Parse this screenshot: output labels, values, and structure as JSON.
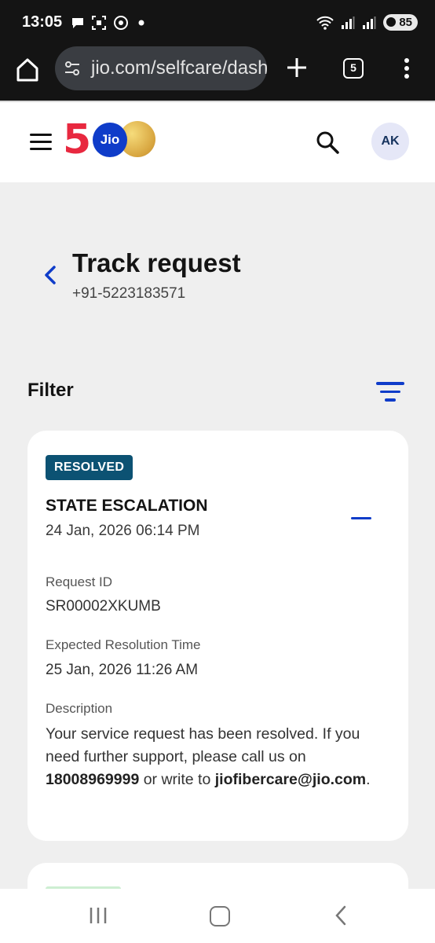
{
  "status_bar": {
    "time": "13:05",
    "battery": "85",
    "icons": [
      "chat-icon",
      "screenshot-icon",
      "whatsapp-icon",
      "dot-icon",
      "wifi-icon",
      "signal-icon",
      "signal-icon",
      "battery-icon"
    ]
  },
  "browser": {
    "url": "jio.com/selfcare/dashboard",
    "tab_count": "5",
    "icons": [
      "home-icon",
      "tune-icon",
      "plus-icon",
      "tabs-icon",
      "more-vert-icon"
    ]
  },
  "header": {
    "logo_number": "5",
    "logo_brand": "Jio",
    "avatar_initials": "AK",
    "icons": [
      "hamburger-icon",
      "search-icon"
    ]
  },
  "page": {
    "title": "Track request",
    "phone": "+91-5223183571",
    "filter_label": "Filter"
  },
  "request": {
    "status": "RESOLVED",
    "title": "STATE ESCALATION",
    "date": "24 Jan, 2026 06:14 PM",
    "request_id_label": "Request ID",
    "request_id": "SR00002XKUMB",
    "expected_label": "Expected Resolution Time",
    "expected_time": "25 Jan, 2026 11:26 AM",
    "description_label": "Description",
    "description_part1": "Your service request has been resolved. If you need further support, please call us on ",
    "description_phone": "18008969999",
    "description_part2": " or write to ",
    "description_email": "jiofibercare@jio.com",
    "description_part3": ".",
    "status_color": "#0c5273"
  },
  "colors": {
    "accent": "#0f3cc9",
    "brand_red": "#e8283f"
  }
}
